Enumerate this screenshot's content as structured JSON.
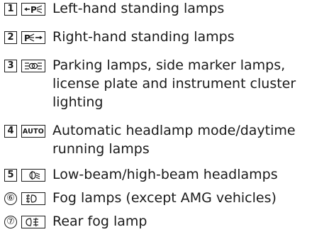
{
  "items": [
    {
      "number": "1",
      "symbol": "left-standing-lamps-icon",
      "text": "Left-hand standing lamps"
    },
    {
      "number": "2",
      "symbol": "right-standing-lamps-icon",
      "text": "Right-hand standing lamps"
    },
    {
      "number": "3",
      "symbol": "parking-lamps-icon",
      "text": "Parking lamps, side marker lamps, license plate and instrument cluster lighting"
    },
    {
      "number": "4",
      "symbol": "AUTO",
      "text": "Automatic headlamp mode/daytime running lamps"
    },
    {
      "number": "5",
      "symbol": "low-beam-icon",
      "text": "Low-beam/high-beam headlamps"
    },
    {
      "number": "⑥",
      "symbol": "fog-lamps-icon",
      "text": "Fog lamps (except AMG vehicles)"
    },
    {
      "number": "⑦",
      "symbol": "rear-fog-lamp-icon",
      "text": "Rear fog lamp"
    }
  ]
}
